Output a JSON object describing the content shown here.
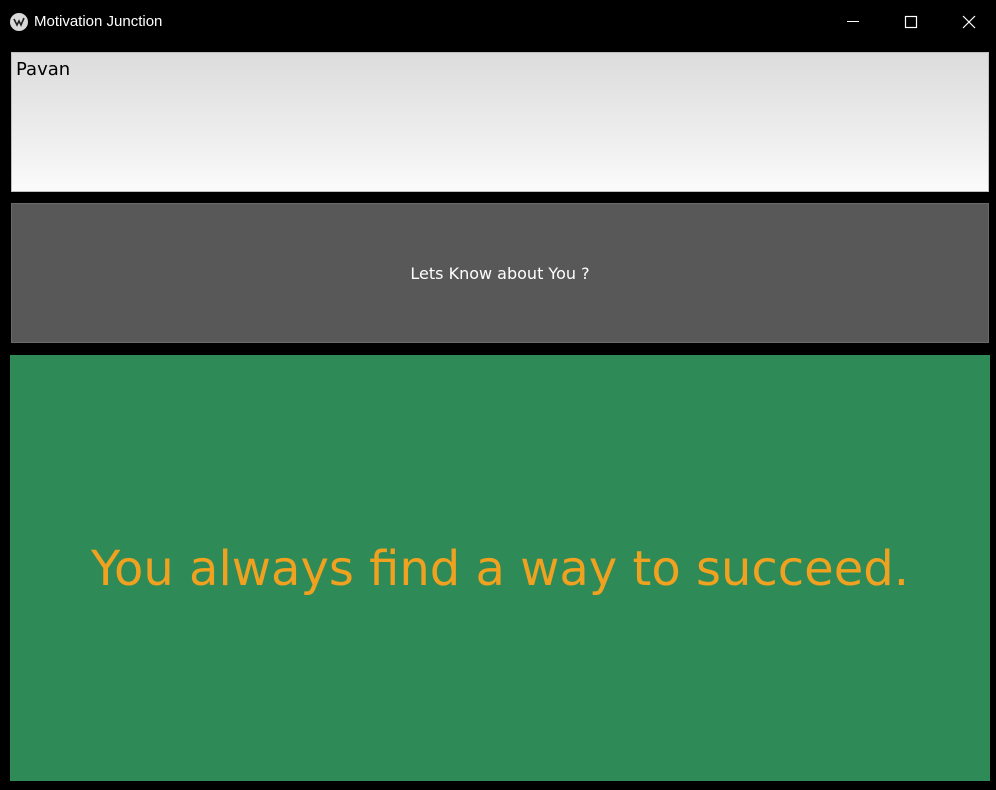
{
  "window": {
    "title": "Motivation Junction",
    "icon": "kivy-app-icon",
    "controls": {
      "minimize_icon": "minimize-icon",
      "maximize_icon": "maximize-icon",
      "close_icon": "close-icon"
    }
  },
  "form": {
    "name_value": "Pavan",
    "button_label": "Lets Know about You ?"
  },
  "quote": {
    "text": "You always find a way to succeed."
  },
  "colors": {
    "background": "#000000",
    "input_bg": "#ececec",
    "button_bg": "#585858",
    "quote_panel_bg": "#2e8b57",
    "quote_text": "#f0a11f"
  }
}
